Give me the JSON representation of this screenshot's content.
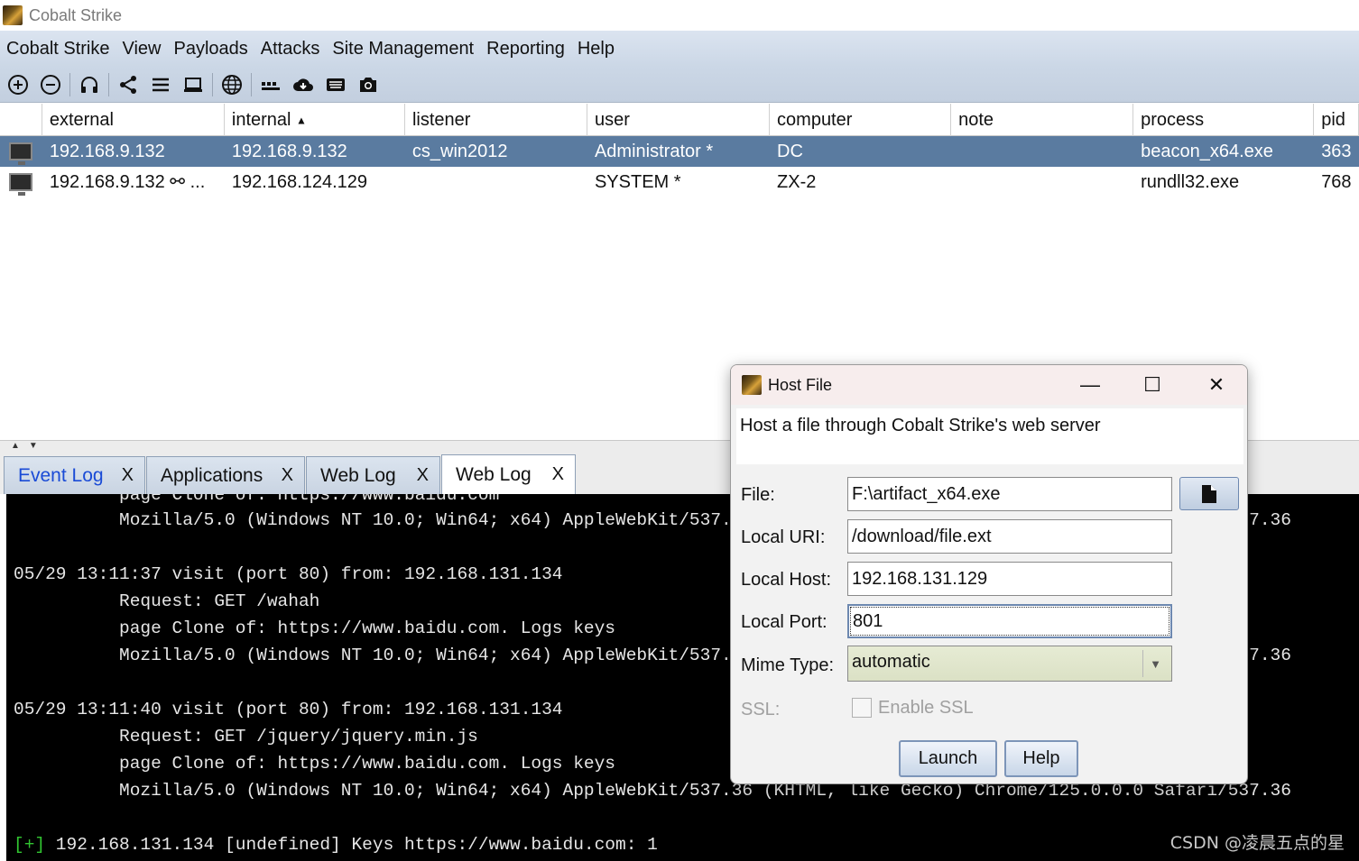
{
  "window": {
    "title": "Cobalt Strike"
  },
  "menu": [
    "Cobalt Strike",
    "View",
    "Payloads",
    "Attacks",
    "Site Management",
    "Reporting",
    "Help"
  ],
  "toolbar": {
    "icons": [
      "new-connection-icon",
      "disconnect-icon",
      "listeners-headphones-icon",
      "pivot-graph-icon",
      "session-table-icon",
      "targets-icon",
      "web-drive-by-icon",
      "keystrokes-icon",
      "downloads-cloud-icon",
      "credentials-icon",
      "screenshots-camera-icon"
    ]
  },
  "sessions": {
    "columns": [
      "",
      "external",
      "internal",
      "listener",
      "user",
      "computer",
      "note",
      "process",
      "pid"
    ],
    "sort_indicator": "▲",
    "rows": [
      {
        "external": "192.168.9.132",
        "internal": "192.168.9.132",
        "listener": "cs_win2012",
        "user": "Administrator *",
        "computer": "DC",
        "note": "",
        "process": "beacon_x64.exe",
        "pid": "363",
        "selected": true
      },
      {
        "external": "192.168.9.132 ⚯ ...",
        "internal": "192.168.124.129",
        "listener": "",
        "user": "SYSTEM *",
        "computer": "ZX-2",
        "note": "",
        "process": "rundll32.exe",
        "pid": "768",
        "selected": false
      }
    ]
  },
  "splitter": {
    "arrows": "▲▼"
  },
  "tabs": [
    {
      "label": "Event Log",
      "close": "X"
    },
    {
      "label": "Applications",
      "close": "X"
    },
    {
      "label": "Web Log",
      "close": "X"
    },
    {
      "label": "Web Log",
      "close": "X",
      "active": true
    }
  ],
  "console": {
    "lines": [
      "          page Clone of: https://www.baidu.com",
      "          Mozilla/5.0 (Windows NT 10.0; Win64; x64) AppleWebKit/537.36 (KHTML, like Gecko) Chrome/125.0.0.0 Safari/537.36",
      "",
      "05/29 13:11:37 visit (port 80) from: 192.168.131.134",
      "          Request: GET /wahah",
      "          page Clone of: https://www.baidu.com. Logs keys",
      "          Mozilla/5.0 (Windows NT 10.0; Win64; x64) AppleWebKit/537.36 (KHTML, like Gecko) Chrome/125.0.0.0 Safari/537.36",
      "",
      "05/29 13:11:40 visit (port 80) from: 192.168.131.134",
      "          Request: GET /jquery/jquery.min.js",
      "          page Clone of: https://www.baidu.com. Logs keys",
      "          Mozilla/5.0 (Windows NT 10.0; Win64; x64) AppleWebKit/537.36 (KHTML, like Gecko) Chrome/125.0.0.0 Safari/537.36",
      ""
    ],
    "last_prefix": "[+]",
    "last_text": " 192.168.131.134 [undefined] Keys https://www.baidu.com: 1"
  },
  "watermark": "CSDN @凌晨五点的星",
  "dialog": {
    "title": "Host File",
    "minimize": "—",
    "maximize": "☐",
    "close": "✕",
    "description": "Host a file through Cobalt Strike's web server",
    "file_label": "File:",
    "file_value": "F:\\artifact_x64.exe",
    "uri_label": "Local URI:",
    "uri_value": "/download/file.ext",
    "host_label": "Local Host:",
    "host_value": "192.168.131.129",
    "port_label": "Local Port:",
    "port_value": "801",
    "mime_label": "Mime Type:",
    "mime_value": "automatic",
    "ssl_label": "SSL:",
    "ssl_checkbox_label": "Enable SSL",
    "launch": "Launch",
    "help": "Help"
  }
}
